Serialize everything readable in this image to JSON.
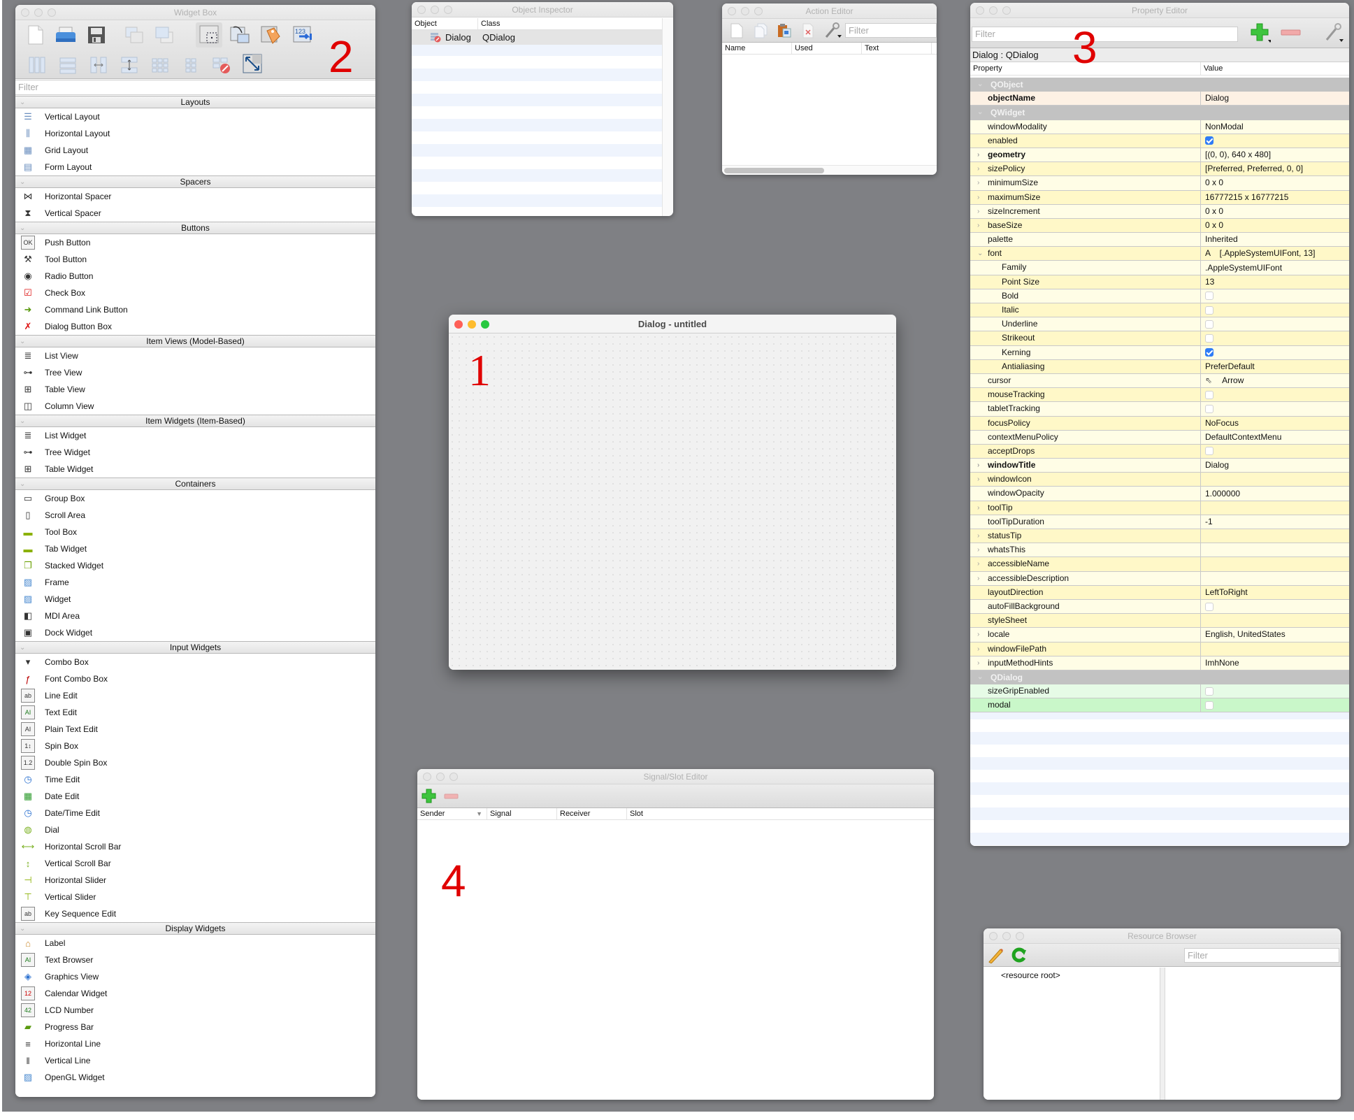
{
  "annotations": [
    "1",
    "2",
    "3",
    "4"
  ],
  "widget_box": {
    "title": "Widget Box",
    "toolbar_icons": [
      "new-form-icon",
      "open-form-icon",
      "save-form-icon",
      "send-to-back-icon",
      "bring-to-front-icon",
      "edit-widgets-icon",
      "edit-signals-slots-icon",
      "edit-buddies-icon",
      "edit-tab-order-icon",
      "lay-out-horizontally-icon",
      "lay-out-vertically-icon",
      "lay-out-horizontal-splitter-icon",
      "lay-out-vertical-splitter-icon",
      "lay-out-grid-icon",
      "lay-out-form-icon",
      "break-layout-icon",
      "adjust-size-icon"
    ],
    "filter_placeholder": "Filter",
    "categories": [
      {
        "name": "Layouts",
        "items": [
          {
            "label": "Vertical Layout",
            "icon": "vertical-layout-icon"
          },
          {
            "label": "Horizontal Layout",
            "icon": "horizontal-layout-icon"
          },
          {
            "label": "Grid Layout",
            "icon": "grid-layout-icon"
          },
          {
            "label": "Form Layout",
            "icon": "form-layout-icon"
          }
        ]
      },
      {
        "name": "Spacers",
        "items": [
          {
            "label": "Horizontal Spacer",
            "icon": "horizontal-spacer-icon"
          },
          {
            "label": "Vertical Spacer",
            "icon": "vertical-spacer-icon"
          }
        ]
      },
      {
        "name": "Buttons",
        "items": [
          {
            "label": "Push Button",
            "icon": "push-button-icon"
          },
          {
            "label": "Tool Button",
            "icon": "tool-button-icon"
          },
          {
            "label": "Radio Button",
            "icon": "radio-button-icon"
          },
          {
            "label": "Check Box",
            "icon": "check-box-icon"
          },
          {
            "label": "Command Link Button",
            "icon": "command-link-icon"
          },
          {
            "label": "Dialog Button Box",
            "icon": "dialog-button-box-icon"
          }
        ]
      },
      {
        "name": "Item Views (Model-Based)",
        "items": [
          {
            "label": "List View",
            "icon": "list-view-icon"
          },
          {
            "label": "Tree View",
            "icon": "tree-view-icon"
          },
          {
            "label": "Table View",
            "icon": "table-view-icon"
          },
          {
            "label": "Column View",
            "icon": "column-view-icon"
          }
        ]
      },
      {
        "name": "Item Widgets (Item-Based)",
        "items": [
          {
            "label": "List Widget",
            "icon": "list-widget-icon"
          },
          {
            "label": "Tree Widget",
            "icon": "tree-widget-icon"
          },
          {
            "label": "Table Widget",
            "icon": "table-widget-icon"
          }
        ]
      },
      {
        "name": "Containers",
        "items": [
          {
            "label": "Group Box",
            "icon": "group-box-icon"
          },
          {
            "label": "Scroll Area",
            "icon": "scroll-area-icon"
          },
          {
            "label": "Tool Box",
            "icon": "tool-box-icon"
          },
          {
            "label": "Tab Widget",
            "icon": "tab-widget-icon"
          },
          {
            "label": "Stacked Widget",
            "icon": "stacked-widget-icon"
          },
          {
            "label": "Frame",
            "icon": "frame-icon"
          },
          {
            "label": "Widget",
            "icon": "widget-icon"
          },
          {
            "label": "MDI Area",
            "icon": "mdi-area-icon"
          },
          {
            "label": "Dock Widget",
            "icon": "dock-widget-icon"
          }
        ]
      },
      {
        "name": "Input Widgets",
        "items": [
          {
            "label": "Combo Box",
            "icon": "combo-box-icon"
          },
          {
            "label": "Font Combo Box",
            "icon": "font-combo-box-icon"
          },
          {
            "label": "Line Edit",
            "icon": "line-edit-icon"
          },
          {
            "label": "Text Edit",
            "icon": "text-edit-icon"
          },
          {
            "label": "Plain Text Edit",
            "icon": "plain-text-edit-icon"
          },
          {
            "label": "Spin Box",
            "icon": "spin-box-icon"
          },
          {
            "label": "Double Spin Box",
            "icon": "double-spin-box-icon"
          },
          {
            "label": "Time Edit",
            "icon": "time-edit-icon"
          },
          {
            "label": "Date Edit",
            "icon": "date-edit-icon"
          },
          {
            "label": "Date/Time Edit",
            "icon": "date-time-edit-icon"
          },
          {
            "label": "Dial",
            "icon": "dial-icon"
          },
          {
            "label": "Horizontal Scroll Bar",
            "icon": "horizontal-scroll-bar-icon"
          },
          {
            "label": "Vertical Scroll Bar",
            "icon": "vertical-scroll-bar-icon"
          },
          {
            "label": "Horizontal Slider",
            "icon": "horizontal-slider-icon"
          },
          {
            "label": "Vertical Slider",
            "icon": "vertical-slider-icon"
          },
          {
            "label": "Key Sequence Edit",
            "icon": "key-sequence-edit-icon"
          }
        ]
      },
      {
        "name": "Display Widgets",
        "items": [
          {
            "label": "Label",
            "icon": "label-icon"
          },
          {
            "label": "Text Browser",
            "icon": "text-browser-icon"
          },
          {
            "label": "Graphics View",
            "icon": "graphics-view-icon"
          },
          {
            "label": "Calendar Widget",
            "icon": "calendar-widget-icon"
          },
          {
            "label": "LCD Number",
            "icon": "lcd-number-icon"
          },
          {
            "label": "Progress Bar",
            "icon": "progress-bar-icon"
          },
          {
            "label": "Horizontal Line",
            "icon": "horizontal-line-icon"
          },
          {
            "label": "Vertical Line",
            "icon": "vertical-line-icon"
          },
          {
            "label": "OpenGL Widget",
            "icon": "opengl-widget-icon"
          }
        ]
      }
    ]
  },
  "object_inspector": {
    "title": "Object Inspector",
    "columns": [
      "Object",
      "Class"
    ],
    "rows": [
      {
        "object": "Dialog",
        "class": "QDialog"
      }
    ]
  },
  "action_editor": {
    "title": "Action Editor",
    "filter_placeholder": "Filter",
    "columns": [
      "Name",
      "Used",
      "Text"
    ]
  },
  "property_editor": {
    "title": "Property Editor",
    "filter_placeholder": "Filter",
    "object_label": "Dialog : QDialog",
    "columns": [
      "Property",
      "Value"
    ],
    "groups": [
      {
        "name": "QObject",
        "tint": "#fdf1e4",
        "tint_alt": "#fdf1e4",
        "rows": [
          {
            "name": "objectName",
            "value": "Dialog",
            "bold": true
          }
        ]
      },
      {
        "name": "QWidget",
        "tint": "#fffde6",
        "tint_alt": "#fff8c8",
        "rows": [
          {
            "name": "windowModality",
            "value": "NonModal"
          },
          {
            "name": "enabled",
            "check": true
          },
          {
            "name": "geometry",
            "value": "[(0, 0), 640 x 480]",
            "bold": true,
            "expandable": true
          },
          {
            "name": "sizePolicy",
            "value": "[Preferred, Preferred, 0, 0]",
            "expandable": true
          },
          {
            "name": "minimumSize",
            "value": "0 x 0",
            "expandable": true
          },
          {
            "name": "maximumSize",
            "value": "16777215 x 16777215",
            "expandable": true
          },
          {
            "name": "sizeIncrement",
            "value": "0 x 0",
            "expandable": true
          },
          {
            "name": "baseSize",
            "value": "0 x 0",
            "expandable": true
          },
          {
            "name": "palette",
            "value": "Inherited"
          },
          {
            "name": "font",
            "value": "A    [.AppleSystemUIFont, 13]",
            "expanded": true
          },
          {
            "name": "Family",
            "value": ".AppleSystemUIFont",
            "sub": true
          },
          {
            "name": "Point Size",
            "value": "13",
            "sub": true
          },
          {
            "name": "Bold",
            "check": false,
            "sub": true
          },
          {
            "name": "Italic",
            "check": false,
            "sub": true
          },
          {
            "name": "Underline",
            "check": false,
            "sub": true
          },
          {
            "name": "Strikeout",
            "check": false,
            "sub": true
          },
          {
            "name": "Kerning",
            "check": true,
            "sub": true
          },
          {
            "name": "Antialiasing",
            "value": "PreferDefault",
            "sub": true
          },
          {
            "name": "cursor",
            "value": "Arrow",
            "cursor_icon": true
          },
          {
            "name": "mouseTracking",
            "check": false
          },
          {
            "name": "tabletTracking",
            "check": false
          },
          {
            "name": "focusPolicy",
            "value": "NoFocus"
          },
          {
            "name": "contextMenuPolicy",
            "value": "DefaultContextMenu"
          },
          {
            "name": "acceptDrops",
            "check": false
          },
          {
            "name": "windowTitle",
            "value": "Dialog",
            "bold": true,
            "expandable": true
          },
          {
            "name": "windowIcon",
            "value": "",
            "expandable": true
          },
          {
            "name": "windowOpacity",
            "value": "1.000000"
          },
          {
            "name": "toolTip",
            "value": "",
            "expandable": true
          },
          {
            "name": "toolTipDuration",
            "value": "-1"
          },
          {
            "name": "statusTip",
            "value": "",
            "expandable": true
          },
          {
            "name": "whatsThis",
            "value": "",
            "expandable": true
          },
          {
            "name": "accessibleName",
            "value": "",
            "expandable": true
          },
          {
            "name": "accessibleDescription",
            "value": "",
            "expandable": true
          },
          {
            "name": "layoutDirection",
            "value": "LeftToRight"
          },
          {
            "name": "autoFillBackground",
            "check": false
          },
          {
            "name": "styleSheet",
            "value": ""
          },
          {
            "name": "locale",
            "value": "English, UnitedStates",
            "expandable": true
          },
          {
            "name": "windowFilePath",
            "value": "",
            "expandable": true
          },
          {
            "name": "inputMethodHints",
            "value": "ImhNone",
            "expandable": true
          }
        ]
      },
      {
        "name": "QDialog",
        "tint": "#e6fbe6",
        "tint_alt": "#c9f7c9",
        "rows": [
          {
            "name": "sizeGripEnabled",
            "check": false
          },
          {
            "name": "modal",
            "check": false
          }
        ]
      }
    ]
  },
  "dialog": {
    "title": "Dialog - untitled"
  },
  "signal_slot_editor": {
    "title": "Signal/Slot Editor",
    "columns": [
      "Sender",
      "Signal",
      "Receiver",
      "Slot"
    ]
  },
  "resource_browser": {
    "title": "Resource Browser",
    "filter_placeholder": "Filter",
    "root_label": "<resource root>"
  },
  "colors": {
    "desktop": "#7f8084",
    "annotation": "#e00000",
    "group_header": "#c2c2c2",
    "checkbox_on": "#2f7cf6"
  }
}
